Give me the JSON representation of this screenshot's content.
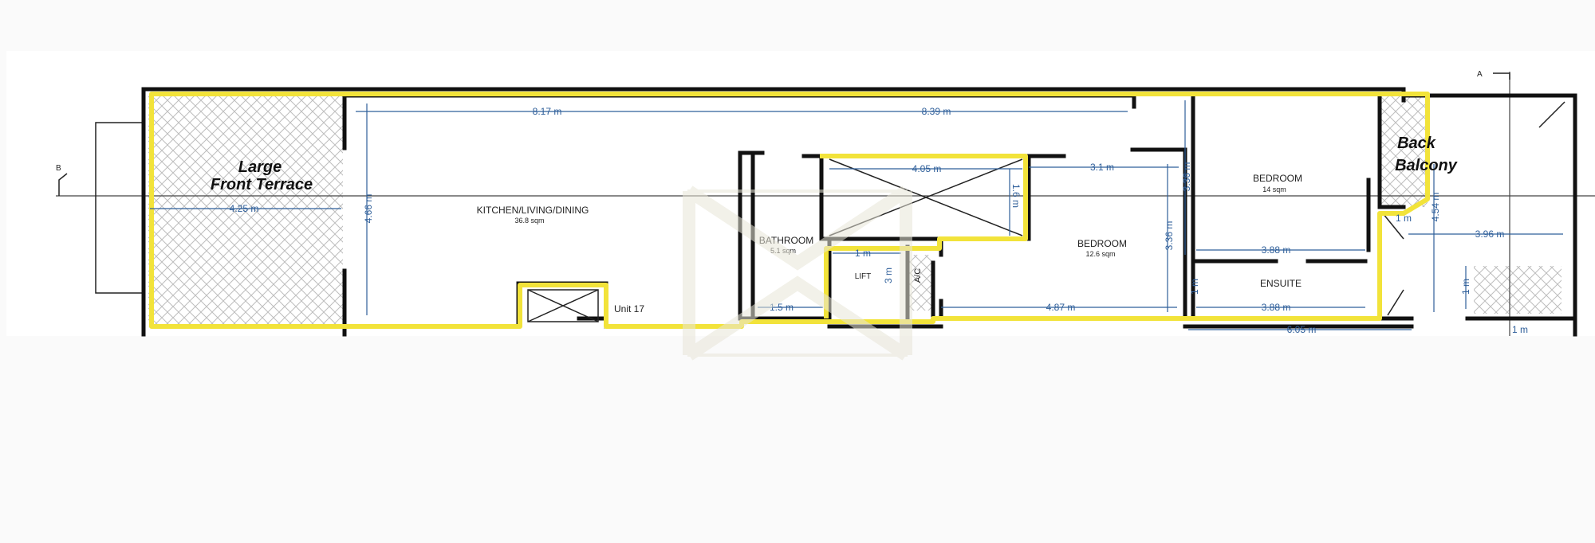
{
  "colors": {
    "highlight": "#f2e33a",
    "dimension": "#2f5f9a",
    "wall": "#111111",
    "watermark": "#e8e6d8"
  },
  "rooms": {
    "front_terrace_1": "Large",
    "front_terrace_2": "Front Terrace",
    "kitchen": "KITCHEN/LIVING/DINING",
    "kitchen_area": "36.8 sqm",
    "bathroom": "BATHROOM",
    "bathroom_area": "5.1 sqm",
    "lift": "LIFT",
    "ac": "A/C",
    "bedroom2": "BEDROOM",
    "bedroom2_area": "12.6 sqm",
    "bedroom1": "BEDROOM",
    "bedroom1_area": "14 sqm",
    "ensuite": "ENSUITE",
    "back_balcony_1": "Back",
    "back_balcony_2": "Balcony",
    "unit": "Unit 17"
  },
  "section_marks": {
    "a": "A",
    "b": "B"
  },
  "dimensions": {
    "d1": "8.17 m",
    "d2": "8.39 m",
    "d3": "4.25 m",
    "d4": "4.66 m",
    "d5": "4.05 m",
    "d6": "3.1 m",
    "d7": "1.6 m",
    "d8": "3.36 m",
    "d9": "4.54 m",
    "d10": "3.96 m",
    "d11": "1 m",
    "d12": "3.88 m",
    "d13": "3.36 m",
    "d14": "1 m",
    "d15": "3.88 m",
    "d16": "4.87 m",
    "d17": "1.5 m",
    "d18": "1 m",
    "d19": "6.05 m",
    "d20": "1 m",
    "d21": "1 m",
    "d22": "3 m"
  }
}
